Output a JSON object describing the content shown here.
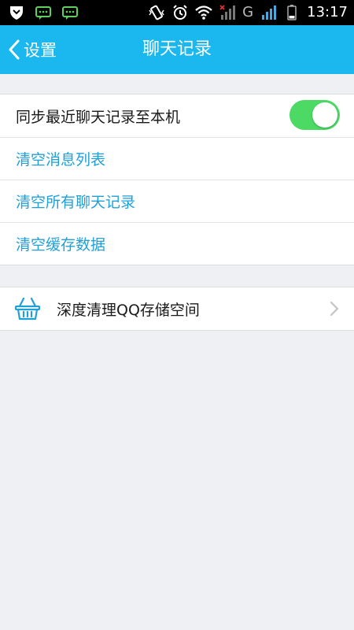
{
  "status_bar": {
    "time": "13:17",
    "network_label": "G"
  },
  "header": {
    "back_label": "设置",
    "title": "聊天记录"
  },
  "settings": {
    "sync_label": "同步最近聊天记录至本机",
    "sync_enabled": true,
    "clear_message_list": "清空消息列表",
    "clear_all_chats": "清空所有聊天记录",
    "clear_cache": "清空缓存数据"
  },
  "storage": {
    "label": "深度清理QQ存储空间"
  },
  "colors": {
    "accent": "#1ab8ee",
    "toggle_on": "#4cd964",
    "link_text": "#20a0d8",
    "background": "#eff0f3"
  }
}
